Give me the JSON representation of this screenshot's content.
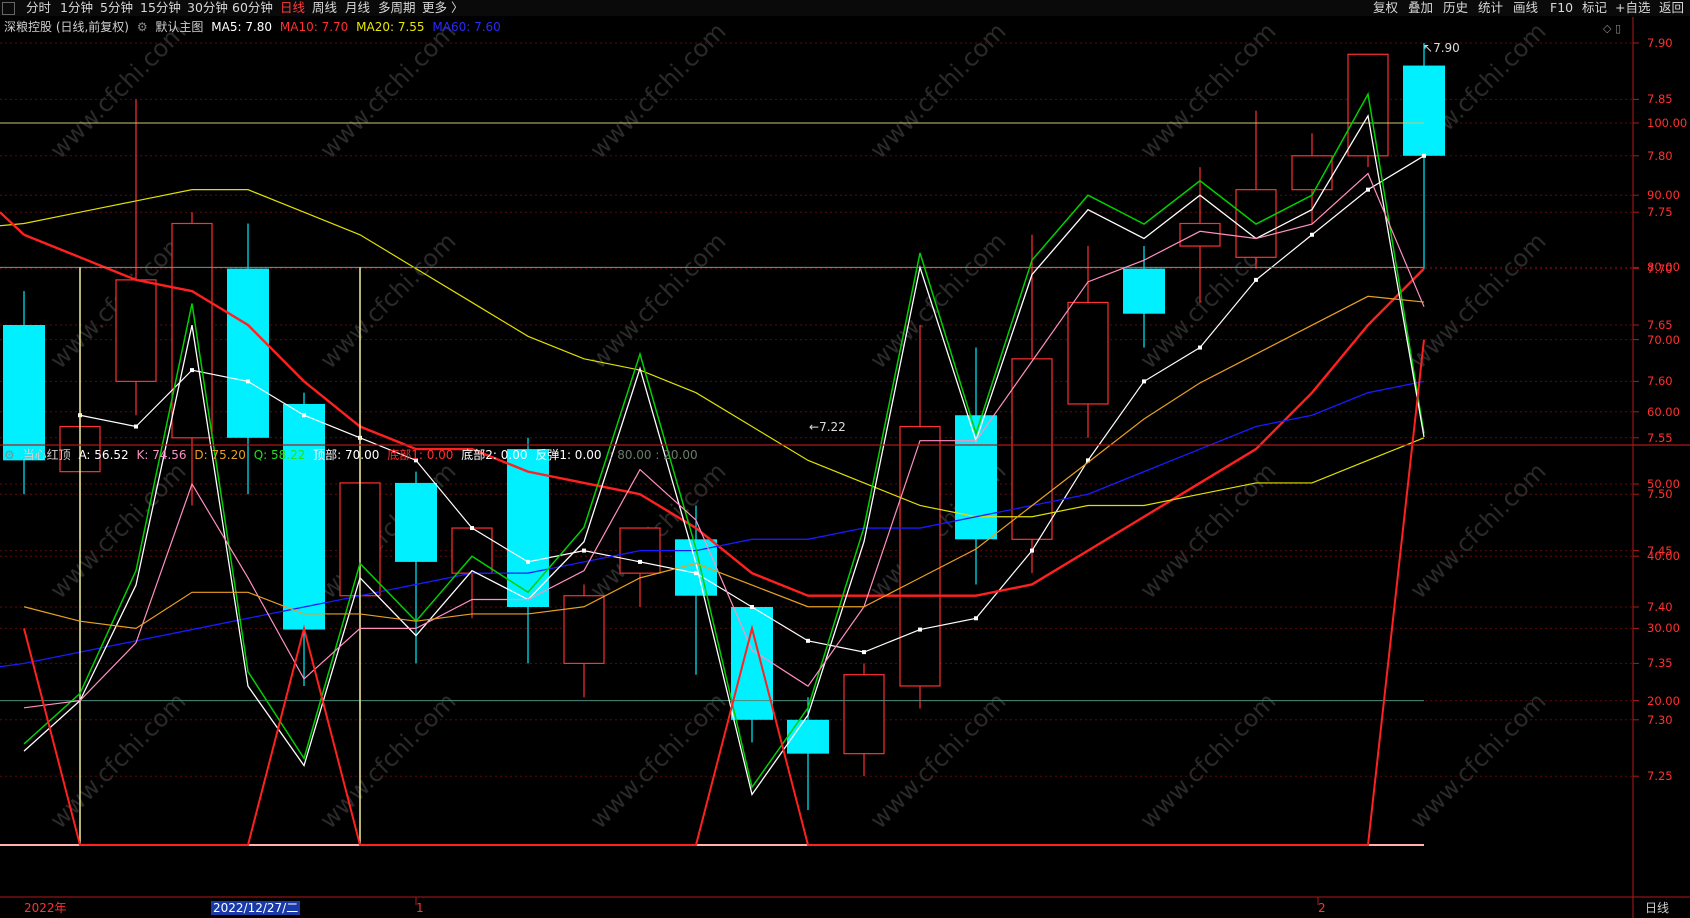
{
  "toolbar": {
    "tabs": [
      "分时",
      "1分钟",
      "5分钟",
      "15分钟",
      "30分钟",
      "60分钟",
      "日线",
      "周线",
      "月线",
      "多周期",
      "更多 〉"
    ],
    "active_tab": "日线",
    "right_buttons": [
      "复权",
      "叠加",
      "历史",
      "统计",
      "画线",
      "F10",
      "标记",
      "+自选",
      "返回"
    ]
  },
  "main_legend": {
    "stock": "深粮控股 (日线,前复权)",
    "template": "默认主图",
    "ma5": "MA5: 7.80",
    "ma10": "MA10: 7.70",
    "ma20": "MA20: 7.55",
    "ma60": "MA60: 7.60"
  },
  "sub_legend": {
    "name": "当心红顶",
    "a": "A: 56.52",
    "k": "K: 74.56",
    "d": "D: 75.20",
    "q": "Q: 58.22",
    "top": "顶部: 70.00",
    "bottom1": "底部1: 0.00",
    "bottom2": "底部2: 0.00",
    "rebound": "反弹1: 0.00",
    "levels": ": 80.00 : 20.00"
  },
  "price_annotations": {
    "high": "7.90",
    "low": "7.22"
  },
  "bottom_bar": {
    "year": "2022年",
    "cursor_date": "2022/12/27/二",
    "m1": "1",
    "m2": "2",
    "period": "日线"
  },
  "watermark": "www.cfchi.com",
  "colors": {
    "up": "#ff3030",
    "down": "#00f0ff",
    "ma5": "#ffffff",
    "ma10": "#ff2020",
    "ma20": "#e0e000",
    "ma60": "#1a1aff"
  },
  "chart_data": [
    {
      "type": "candlestick",
      "title": "深粮控股 (日线,前复权)",
      "ylim": [
        7.2,
        7.95
      ],
      "y_ticks": [
        7.25,
        7.3,
        7.35,
        7.4,
        7.45,
        7.5,
        7.55,
        7.6,
        7.65,
        7.7,
        7.75,
        7.8,
        7.85,
        7.9
      ],
      "ohlc": [
        [
          7.65,
          7.68,
          7.5,
          7.53
        ],
        [
          7.52,
          7.63,
          7.46,
          7.56
        ],
        [
          7.6,
          7.85,
          7.57,
          7.69
        ],
        [
          7.55,
          7.75,
          7.49,
          7.74
        ],
        [
          7.7,
          7.74,
          7.5,
          7.55
        ],
        [
          7.58,
          7.59,
          7.33,
          7.38
        ],
        [
          7.41,
          7.53,
          7.31,
          7.51
        ],
        [
          7.51,
          7.52,
          7.35,
          7.44
        ],
        [
          7.43,
          7.47,
          7.39,
          7.47
        ],
        [
          7.54,
          7.55,
          7.35,
          7.4
        ],
        [
          7.35,
          7.42,
          7.32,
          7.41
        ],
        [
          7.43,
          7.47,
          7.4,
          7.47
        ],
        [
          7.46,
          7.49,
          7.34,
          7.41
        ],
        [
          7.4,
          7.4,
          7.28,
          7.3
        ],
        [
          7.3,
          7.32,
          7.22,
          7.27
        ],
        [
          7.27,
          7.35,
          7.25,
          7.34
        ],
        [
          7.33,
          7.65,
          7.31,
          7.56
        ],
        [
          7.57,
          7.63,
          7.42,
          7.46
        ],
        [
          7.46,
          7.73,
          7.43,
          7.62
        ],
        [
          7.58,
          7.72,
          7.55,
          7.67
        ],
        [
          7.7,
          7.72,
          7.63,
          7.66
        ],
        [
          7.72,
          7.79,
          7.67,
          7.74
        ],
        [
          7.71,
          7.84,
          7.7,
          7.77
        ],
        [
          7.77,
          7.82,
          7.74,
          7.8
        ],
        [
          7.8,
          7.89,
          7.79,
          7.89
        ],
        [
          7.88,
          7.9,
          7.7,
          7.8
        ]
      ],
      "series": [
        {
          "name": "MA5",
          "values": [
            null,
            7.57,
            7.56,
            7.61,
            7.6,
            7.57,
            7.55,
            7.53,
            7.47,
            7.44,
            7.45,
            7.44,
            7.43,
            7.4,
            7.37,
            7.36,
            7.38,
            7.39,
            7.45,
            7.53,
            7.6,
            7.63,
            7.69,
            7.73,
            7.77,
            7.8
          ]
        },
        {
          "name": "MA10",
          "values": [
            7.73,
            7.71,
            7.69,
            7.68,
            7.65,
            7.6,
            7.56,
            7.54,
            7.54,
            7.52,
            7.51,
            7.5,
            7.47,
            7.43,
            7.41,
            7.41,
            7.41,
            7.41,
            7.42,
            7.45,
            7.48,
            7.51,
            7.54,
            7.59,
            7.65,
            7.7
          ]
        },
        {
          "name": "MA20",
          "values": [
            7.74,
            7.75,
            7.76,
            7.77,
            7.77,
            7.75,
            7.73,
            7.7,
            7.67,
            7.64,
            7.62,
            7.61,
            7.59,
            7.56,
            7.53,
            7.51,
            7.49,
            7.48,
            7.48,
            7.49,
            7.49,
            7.5,
            7.51,
            7.51,
            7.53,
            7.55
          ]
        },
        {
          "name": "MA60",
          "values": [
            7.35,
            7.36,
            7.37,
            7.38,
            7.39,
            7.4,
            7.41,
            7.42,
            7.43,
            7.43,
            7.44,
            7.45,
            7.45,
            7.46,
            7.46,
            7.47,
            7.47,
            7.48,
            7.49,
            7.5,
            7.52,
            7.54,
            7.56,
            7.57,
            7.59,
            7.6
          ]
        }
      ]
    },
    {
      "type": "line",
      "title": "当心红顶",
      "ylim": [
        0,
        110
      ],
      "y_ticks": [
        20,
        30,
        40,
        50,
        60,
        70,
        80,
        90,
        100
      ],
      "levels": [
        80,
        20,
        100
      ],
      "series": [
        {
          "name": "Q",
          "color": "#00d000",
          "values": [
            14,
            21,
            38,
            75,
            24,
            12,
            39,
            31,
            40,
            35,
            44,
            68,
            41,
            8,
            19,
            44,
            82,
            57,
            81,
            90,
            86,
            92,
            86,
            90,
            104,
            57
          ]
        },
        {
          "name": "A",
          "color": "#ffffff",
          "values": [
            13,
            20,
            36,
            72,
            22,
            11,
            37,
            29,
            38,
            34,
            42,
            66,
            39,
            7,
            18,
            42,
            80,
            56,
            79,
            88,
            84,
            90,
            84,
            88,
            101,
            56.52
          ]
        },
        {
          "name": "K",
          "color": "#ff90c0",
          "values": [
            19,
            20,
            28,
            50,
            37,
            23,
            30,
            30,
            34,
            34,
            38,
            52,
            45,
            27,
            22,
            33,
            56,
            56,
            67,
            78,
            81,
            85,
            84,
            86,
            93,
            74.56
          ]
        },
        {
          "name": "D",
          "color": "#e8a020",
          "values": [
            33,
            31,
            30,
            35,
            35,
            32,
            32,
            31,
            32,
            32,
            33,
            37,
            39,
            36,
            33,
            33,
            37,
            41,
            47,
            53,
            59,
            64,
            68,
            72,
            76,
            75.2
          ]
        },
        {
          "name": "顶部",
          "color": "#ff2020",
          "values": [
            30,
            0,
            0,
            0,
            0,
            30,
            0,
            0,
            0,
            0,
            0,
            0,
            0,
            30,
            0,
            0,
            0,
            0,
            0,
            0,
            0,
            0,
            0,
            0,
            0,
            70
          ]
        }
      ],
      "signals": [
        1,
        6
      ]
    }
  ]
}
